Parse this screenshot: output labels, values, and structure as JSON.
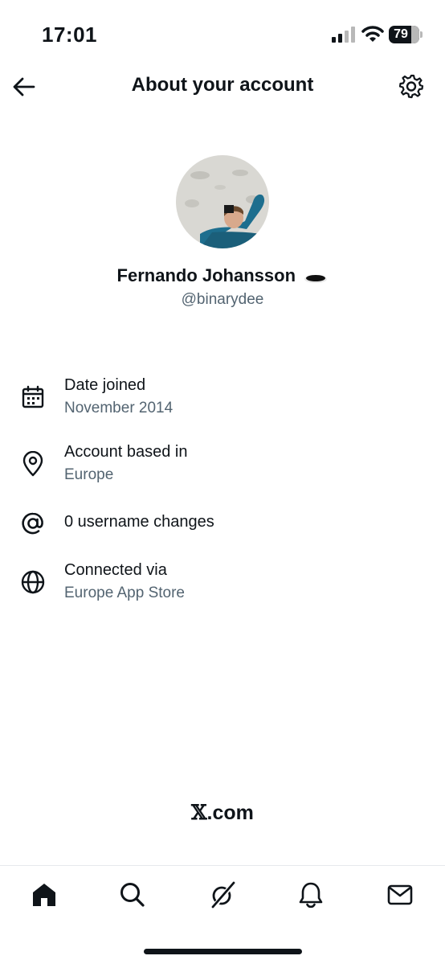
{
  "status_bar": {
    "time": "17:01",
    "battery": "79"
  },
  "header": {
    "title": "About your account"
  },
  "profile": {
    "name": "Fernando Johansson",
    "handle": "@binarydee"
  },
  "info": [
    {
      "icon": "calendar-icon",
      "label": "Date joined",
      "value": "November 2014"
    },
    {
      "icon": "location-pin-icon",
      "label": "Account based in",
      "value": "Europe"
    },
    {
      "icon": "at-sign-icon",
      "label": "0 username changes"
    },
    {
      "icon": "globe-icon",
      "label": "Connected via",
      "value": "Europe App Store"
    }
  ],
  "brand": {
    "x": "𝕏",
    "suffix": ".com"
  },
  "tab_bar": [
    "home-icon",
    "search-icon",
    "grok-icon",
    "notifications-icon",
    "messages-icon"
  ],
  "colors": {
    "text": "#0f1419",
    "secondary": "#536471",
    "divider": "#e6e9ec",
    "avatar_shirt": "#1d6e8e"
  }
}
